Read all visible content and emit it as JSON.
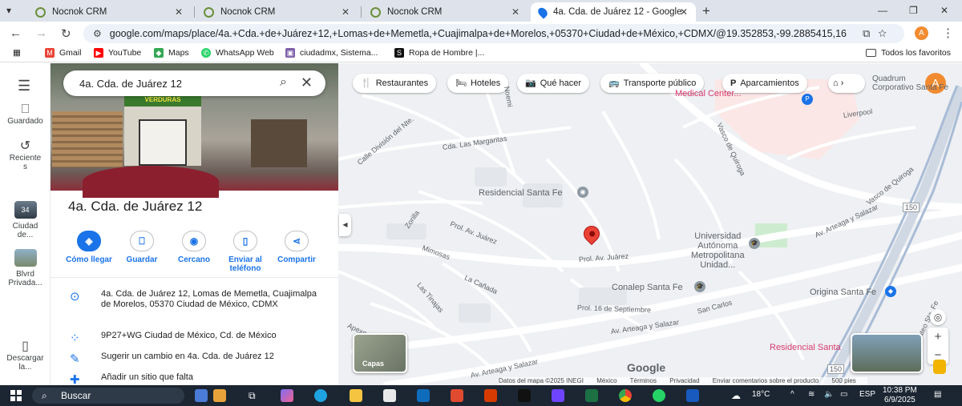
{
  "browser": {
    "tabs": [
      {
        "title": "Nocnok CRM"
      },
      {
        "title": "Nocnok CRM"
      },
      {
        "title": "Nocnok CRM"
      },
      {
        "title": "4a. Cda. de Juárez 12 - Google"
      }
    ],
    "url": "google.com/maps/place/4a.+Cda.+de+Juárez+12,+Lomas+de+Memetla,+Cuajimalpa+de+Morelos,+05370+Ciudad+de+México,+CDMX/@19.352853,-99.2885415,16....",
    "profile_letter": "A"
  },
  "bookmarks": [
    {
      "label": "Gmail",
      "icon": "gmail-icon",
      "color": "#ea4335"
    },
    {
      "label": "YouTube",
      "icon": "youtube-icon",
      "color": "#ff0000"
    },
    {
      "label": "Maps",
      "icon": "maps-icon",
      "color": "#34a853"
    },
    {
      "label": "WhatsApp Web",
      "icon": "whatsapp-icon",
      "color": "#25d366"
    },
    {
      "label": "ciudadmx, Sistema...",
      "icon": "site-icon",
      "color": "#7b5ea7"
    },
    {
      "label": "Ropa de Hombre |...",
      "icon": "s-icon",
      "color": "#111111"
    }
  ],
  "bookmarks_right": "Todos los favoritos",
  "rail": {
    "items": [
      {
        "label": "Guardado"
      },
      {
        "label": "Reciente\ns"
      },
      {
        "label": "Ciudad\nde..."
      },
      {
        "label": "Blvrd\nPrivada..."
      },
      {
        "label": "Descargar\nla..."
      }
    ],
    "recent_badge": "34"
  },
  "place": {
    "search_value": "4a. Cda. de Juárez 12",
    "sign_text": "VERDURAS",
    "title": "4a. Cda. de Juárez 12",
    "actions": [
      {
        "label": "Cómo llegar",
        "icon": "directions-icon"
      },
      {
        "label": "Guardar",
        "icon": "bookmark-icon"
      },
      {
        "label": "Cercano",
        "icon": "nearby-icon"
      },
      {
        "label": "Enviar al\nteléfono",
        "icon": "phone-icon"
      },
      {
        "label": "Compartir",
        "icon": "share-icon"
      }
    ],
    "address": "4a. Cda. de Juárez 12, Lomas de Memetla, Cuajimalpa de Morelos, 05370 Ciudad de México, CDMX",
    "plus_code": "9P27+WG Ciudad de México, Cd. de México",
    "suggest": "Sugerir un cambio en 4a. Cda. de Juárez 12",
    "add_place": "Añadir un sitio que falta"
  },
  "map": {
    "chips": [
      {
        "label": "Restaurantes",
        "icon": "🍴"
      },
      {
        "label": "Hoteles",
        "icon": "🛏"
      },
      {
        "label": "Qué hacer",
        "icon": "📷"
      },
      {
        "label": "Transporte público",
        "icon": "🚌"
      },
      {
        "label": "Aparcamientos",
        "icon": "P"
      }
    ],
    "places": {
      "residencial": "Residencial Santa Fe",
      "universidad": "Universidad\nAutónoma\nMetropolitana\nUnidad...",
      "conalep": "Conalep Santa Fe",
      "origina": "Origina Santa Fe",
      "residencial2": "Residencial Santa",
      "medical": "Medical Center...",
      "quadrum": "Quadrum\nCorporativo Santa Fe"
    },
    "roads": {
      "vasco": "Vasco de Quiroga",
      "vasco2": "Vasco de Quiroga",
      "prolav1": "Prol. Av. Juárez",
      "prolav2": "Prol. Av. Juárez",
      "sept": "Prol. 16 de Septiembre",
      "arteaga1": "Av. Arteaga y Salazar",
      "arteaga2": "Av. Arteaga y Salazar",
      "arteaga3": "Av. Arteaga y Salazar",
      "margaritas": "Cda. Las Margaritas",
      "division": "Calle División del Nte.",
      "zorilla": "Zorilla",
      "mimosas": "Mimosas",
      "canada": "La Cañada",
      "lastinajas": "Las Tinajas",
      "apexoco": "Apexoco",
      "sancarlos": "San Carlos",
      "liverpool": "Liverpool",
      "noemi": "Noemi",
      "mateo": "Carr. San Mateo Sta. Fe",
      "shield": "150",
      "shield2": "150"
    },
    "layers_label": "Capas",
    "logo": "Google",
    "attribution": [
      "Datos del mapa ©2025 INEGI",
      "México",
      "Términos",
      "Privacidad",
      "Enviar comentarios sobre el producto",
      "500 pies"
    ],
    "user_letter": "A"
  },
  "taskbar": {
    "search": "Buscar",
    "weather": "18°C",
    "lang": "ESP",
    "time": "10:38 PM",
    "date": "6/9/2025"
  }
}
